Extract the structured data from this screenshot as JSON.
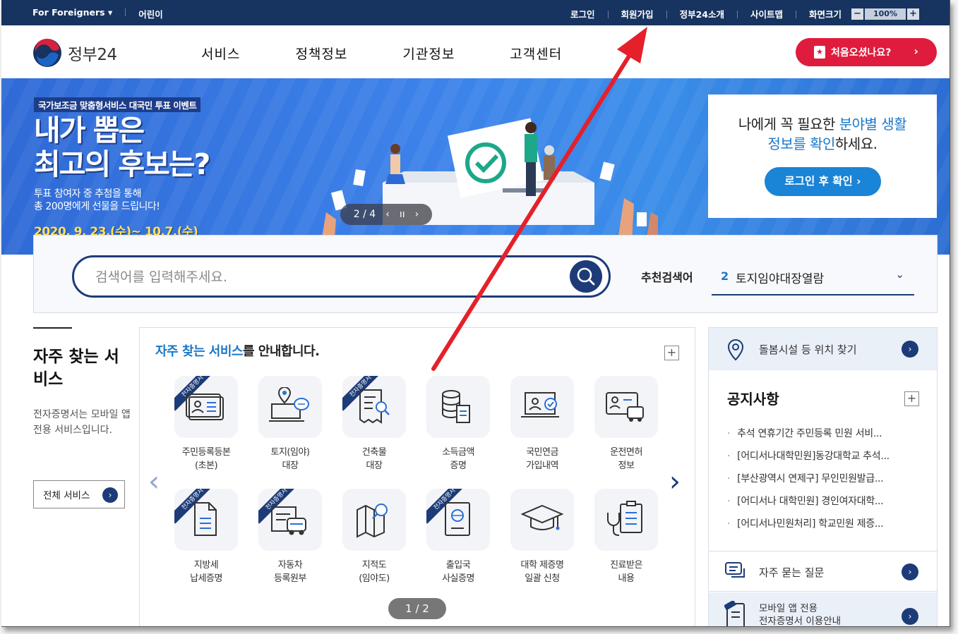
{
  "topbar": {
    "foreigners": "For Foreigners ▾",
    "kids": "어린이",
    "login": "로그인",
    "signup": "회원가입",
    "about": "정부24소개",
    "sitemap": "사이트맵",
    "zoom_label": "화면크기",
    "zoom_minus": "−",
    "zoom_value": "100%",
    "zoom_plus": "+"
  },
  "header": {
    "logo_text": "정부24",
    "nav": [
      "서비스",
      "정책정보",
      "기관정보",
      "고객센터"
    ],
    "first_visit": "처음오셨나요?",
    "first_visit_chevron": "›"
  },
  "banner": {
    "event_tag": "국가보조금 맞춤형서비스 대국민 투표 이벤트",
    "headline_1": "내가 뽑은",
    "headline_2": "최고의 후보는?",
    "sub_1": "투표 참여자 중 추첨을 통해",
    "sub_2": "총 200명에게 선물을 드립니다!",
    "date": "2020. 9. 23.(수)~ 10.7.(수)",
    "pager": "2 / 4",
    "pager_prev": "‹",
    "pager_pause": "ıı",
    "pager_next": "›",
    "card_line1_a": "나에게 꼭 필요한 ",
    "card_line1_b": "분야별 생활",
    "card_line2_a": "정보를 확인",
    "card_line2_b": "하세요.",
    "card_button": "로그인 후 확인 ›"
  },
  "search": {
    "placeholder": "검색어를 입력해주세요.",
    "rec_label": "추천검색어",
    "rec_num": "2",
    "rec_value": "토지임야대장열람",
    "rec_chevron": "⌄"
  },
  "left": {
    "title": "자주 찾는 서비스",
    "desc": "전자증명서는 모바일 앱 전용 서비스입니다.",
    "all_button": "전체 서비스",
    "all_go": "›"
  },
  "services": {
    "title_accent": "자주 찾는 서비스",
    "title_rest": "를 안내합니다.",
    "plus": "+",
    "ribbon": "전자증명서",
    "items": [
      {
        "l1": "주민등록등본",
        "l2": "(초본)",
        "icon": "id-card-icon"
      },
      {
        "l1": "토지(임야)",
        "l2": "대장",
        "icon": "land-map-icon"
      },
      {
        "l1": "건축물",
        "l2": "대장",
        "icon": "building-document-icon"
      },
      {
        "l1": "소득금액",
        "l2": "증명",
        "icon": "income-coins-icon"
      },
      {
        "l1": "국민연금",
        "l2": "가입내역",
        "icon": "pension-icon"
      },
      {
        "l1": "운전면허",
        "l2": "정보",
        "icon": "driver-license-icon"
      },
      {
        "l1": "지방세",
        "l2": "납세증명",
        "icon": "tax-document-icon"
      },
      {
        "l1": "자동차",
        "l2": "등록원부",
        "icon": "car-registration-icon"
      },
      {
        "l1": "지적도",
        "l2": "(임야도)",
        "icon": "cadastral-map-icon"
      },
      {
        "l1": "출입국",
        "l2": "사실증명",
        "icon": "passport-icon"
      },
      {
        "l1": "대학 제증명",
        "l2": "일괄 신청",
        "icon": "graduation-cap-icon"
      },
      {
        "l1": "진료받은",
        "l2": "내용",
        "icon": "medical-record-icon"
      }
    ],
    "pager": "1 / 2",
    "prev": "‹",
    "next": "›"
  },
  "right": {
    "location": "돌봄시설 등 위치 찾기",
    "notice_title": "공지사항",
    "notice_plus": "+",
    "notices": [
      "추석 연휴기간 주민등록 민원 서비...",
      "[어디서나대학민원]동강대학교 추석...",
      "[부산광역시 연제구] 무인민원발급...",
      "[어디서나 대학민원] 경인여자대학...",
      "[어디서나민원처리] 학교민원 제증..."
    ],
    "faq": "자주 묻는 질문",
    "mobile_1": "모바일 앱 전용",
    "mobile_2": "전자증명서 이용안내",
    "go": "›"
  },
  "colors": {
    "navy": "#17335f",
    "accent_blue": "#1a77c9",
    "red_button": "#df1c3d",
    "annotation_arrow": "#e5202a"
  }
}
